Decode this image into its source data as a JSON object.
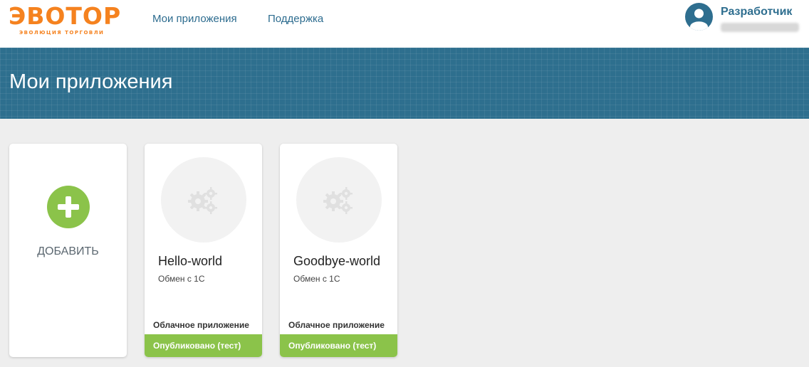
{
  "brand": {
    "logo_text": "ЭВОТОР",
    "logo_tagline": "ЭВОЛЮЦИЯ ТОРГОВЛИ",
    "accent_color": "#f5821f"
  },
  "nav": {
    "items": [
      {
        "label": "Мои приложения"
      },
      {
        "label": "Поддержка"
      }
    ]
  },
  "user": {
    "name": "Разработчик",
    "avatar_icon": "user-avatar-icon"
  },
  "banner": {
    "title": "Мои приложения",
    "color": "#2e6f8e"
  },
  "add_card": {
    "label": "ДОБАВИТЬ",
    "icon": "plus-icon",
    "color": "#8bc34a"
  },
  "apps": [
    {
      "name": "Hello-world",
      "description": "Обмен с 1С",
      "type": "Облачное приложение",
      "status": "Опубликовано (тест)",
      "icon": "gears-icon"
    },
    {
      "name": "Goodbye-world",
      "description": "Обмен с 1С",
      "type": "Облачное приложение",
      "status": "Опубликовано (тест)",
      "icon": "gears-icon"
    }
  ]
}
